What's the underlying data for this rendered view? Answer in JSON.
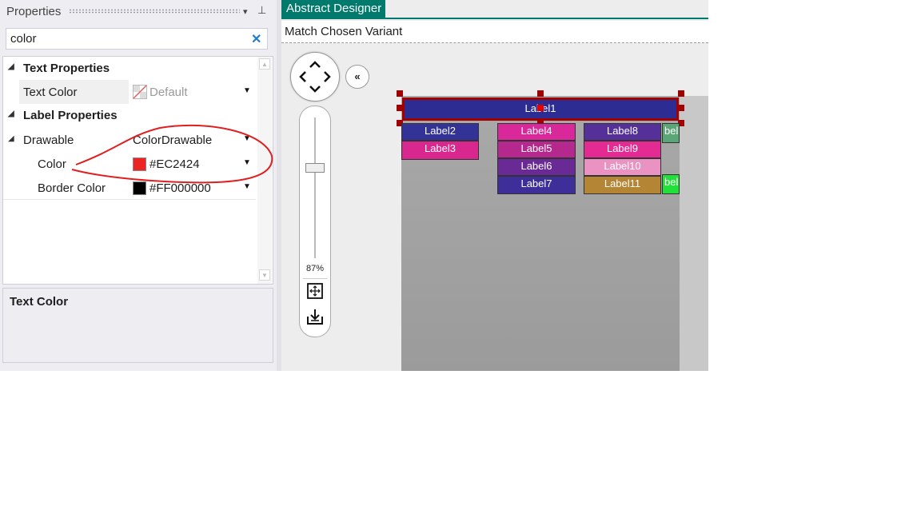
{
  "properties_panel": {
    "title": "Properties",
    "dropdown_glyph": "▾",
    "pin_glyph": "⊥",
    "search": {
      "value": "color",
      "clear_glyph": "✕"
    },
    "categories": [
      {
        "label": "Text Properties",
        "expander": "◢"
      },
      {
        "label": "Label Properties",
        "expander": "◢"
      }
    ],
    "rows": {
      "text_color": {
        "name": "Text Color",
        "value": "Default"
      },
      "drawable": {
        "name": "Drawable",
        "value": "ColorDrawable",
        "expander": "◢"
      },
      "color": {
        "name": "Color",
        "value": "#EC2424",
        "swatch": "#EC2424"
      },
      "border_color": {
        "name": "Border Color",
        "value": "#FF000000",
        "swatch": "#000000"
      }
    },
    "dropdown_arrow": "▼",
    "scroll_up": "▲",
    "scroll_down": "▼",
    "description_title": "Text Color"
  },
  "designer": {
    "tab_label": "Abstract Designer",
    "variant_label": "Match Chosen Variant",
    "zoom": "87%",
    "collapse_glyph": "«",
    "labels": {
      "label1": "Label1",
      "label2": "Label2",
      "label3": "Label3",
      "label4": "Label4",
      "label5": "Label5",
      "label6": "Label6",
      "label7": "Label7",
      "label8": "Label8",
      "label9": "Label9",
      "label10": "Label10",
      "label11": "Label11",
      "label12_partial": "bel",
      "label13_partial": "bel"
    },
    "colors": {
      "accent_tab": "#007A6C",
      "selection": "#A00000",
      "annotation": "#E02020"
    }
  }
}
